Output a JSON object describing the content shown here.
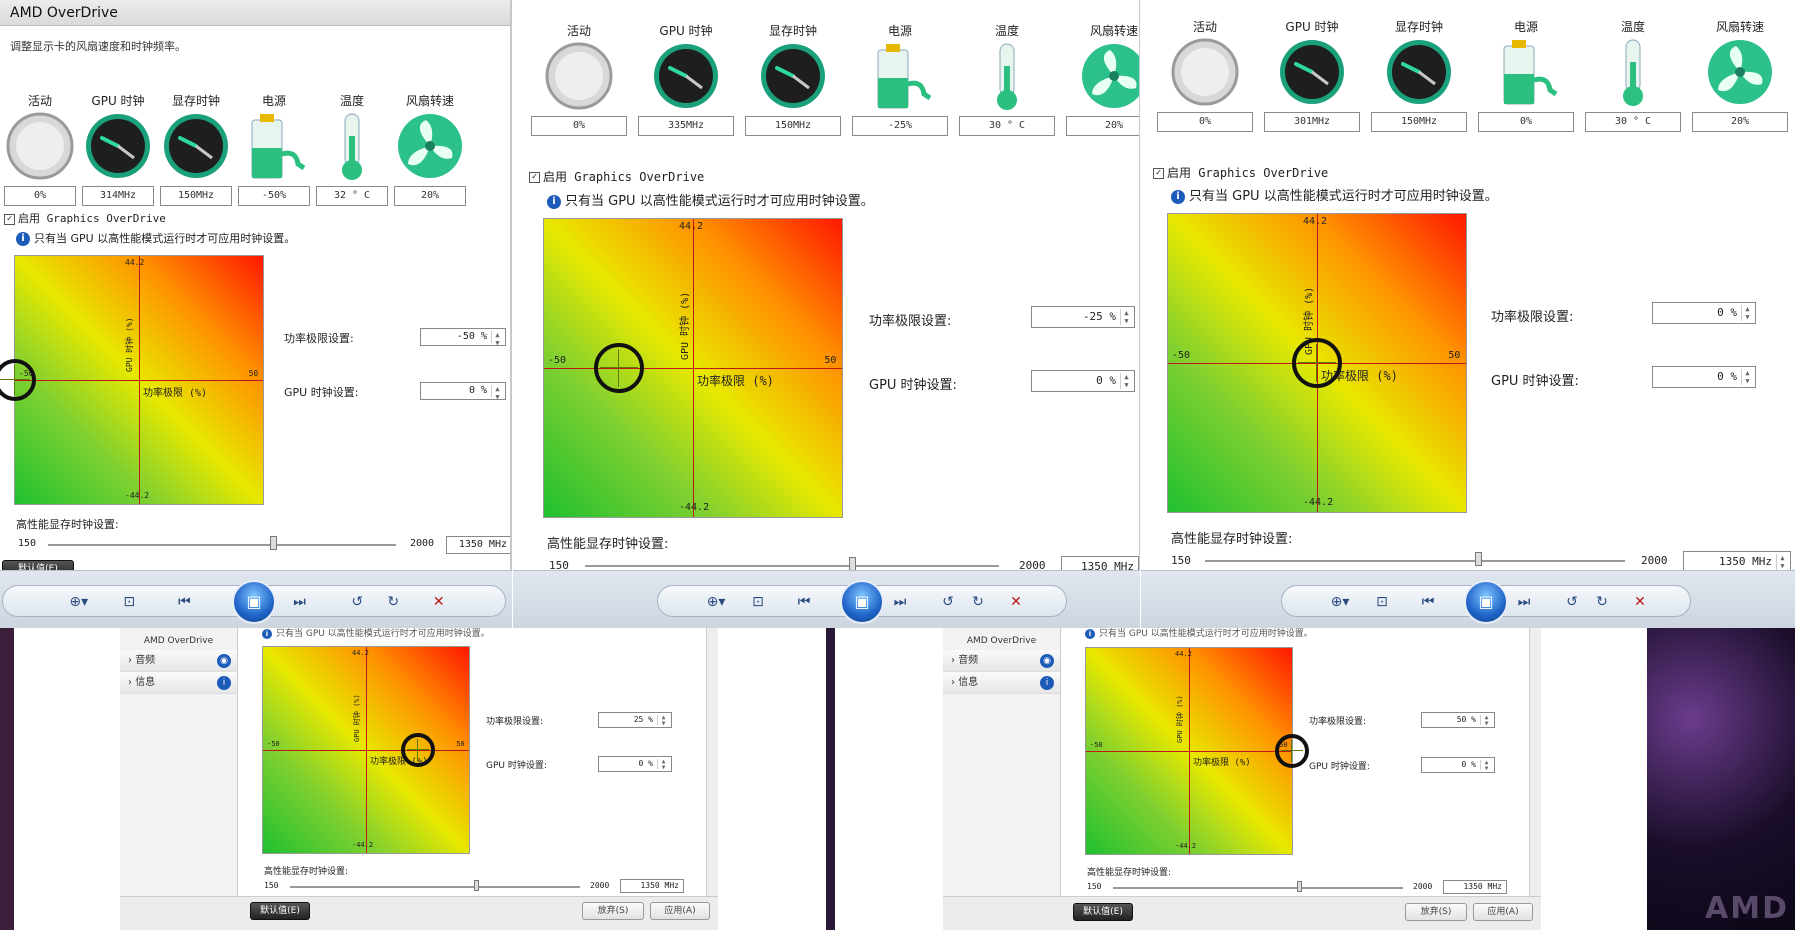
{
  "window_title": "AMD OverDrive",
  "subtitle": "调整显示卡的风扇速度和时钟频率。",
  "gauge_labels": [
    "活动",
    "GPU 时钟",
    "显存时钟",
    "电源",
    "温度",
    "风扇转速"
  ],
  "enable_label": "启用 Graphics OverDrive",
  "info_text": "只有当 GPU 以高性能模式运行时才可应用时钟设置。",
  "axis": {
    "top": "44.2",
    "bottom": "-44.2",
    "left": "-50",
    "right": "50",
    "x_label": "功率极限 (%)",
    "y_label": "GPU 时钟 (%)"
  },
  "power_limit_label": "功率极限设置:",
  "gpu_clock_label": "GPU 时钟设置:",
  "mem_clock_label": "高性能显存时钟设置:",
  "slider_min": "150",
  "slider_max": "2000",
  "mem_value": "1350 MHz",
  "panels": [
    {
      "gauges": [
        "0%",
        "314MHz",
        "150MHz",
        "-50%",
        "32 ° C",
        "20%"
      ],
      "power": "-50 %",
      "gpu": "0 %",
      "power_limit": -50
    },
    {
      "gauges": [
        "0%",
        "335MHz",
        "150MHz",
        "-25%",
        "30 ° C",
        "20%"
      ],
      "power": "-25 %",
      "gpu": "0 %",
      "power_limit": -25
    },
    {
      "gauges": [
        "0%",
        "301MHz",
        "150MHz",
        "0%",
        "30 ° C",
        "20%"
      ],
      "power": "0 %",
      "gpu": "0 %",
      "power_limit": 0
    },
    {
      "power": "25 %",
      "gpu": "0 %",
      "power_limit": 25
    },
    {
      "power": "50 %",
      "gpu": "0 %",
      "power_limit": 50
    }
  ],
  "sidebar": {
    "title": "AMD OverDrive",
    "items": [
      "音频",
      "信息"
    ]
  },
  "buttons": {
    "default": "默认值(E)",
    "discard": "放弃(S)",
    "apply": "应用(A)"
  },
  "wallpaper_text": "AMD"
}
